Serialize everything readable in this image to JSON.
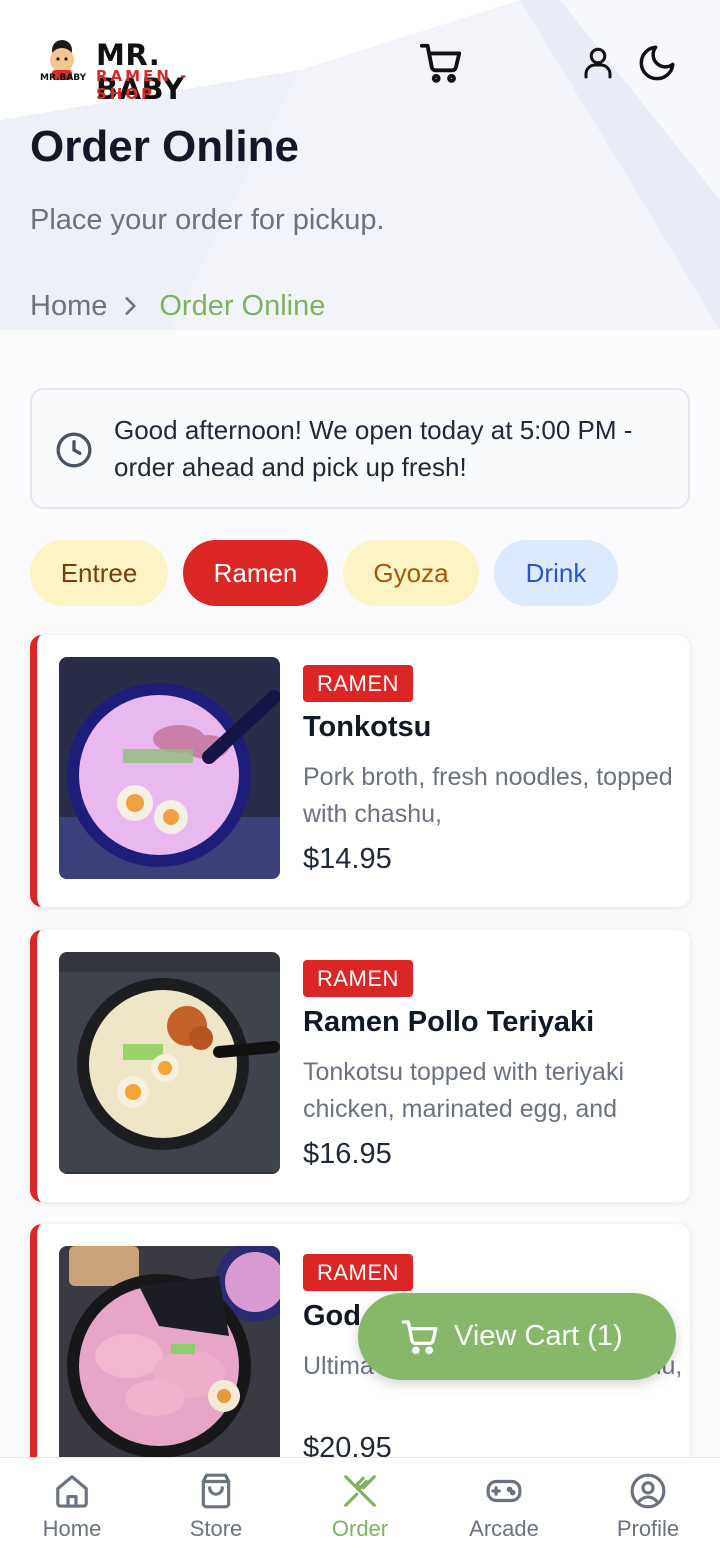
{
  "header": {
    "logo_title": "MR. BABY",
    "logo_sub": "RAMEN - SHOP"
  },
  "page": {
    "title": "Order Online",
    "subtitle": "Place your order for pickup."
  },
  "breadcrumb": {
    "home": "Home",
    "current": "Order Online"
  },
  "notice": {
    "text": "Good afternoon! We open today at 5:00 PM - order ahead and pick up fresh!"
  },
  "categories": [
    {
      "label": "Entree",
      "color": "#fdf4c6"
    },
    {
      "label": "Ramen",
      "color": "#dc2626",
      "selected": true
    },
    {
      "label": "Gyoza",
      "color": "#fdf4c6"
    },
    {
      "label": "Drink",
      "color": "#dbeafe"
    }
  ],
  "menu_items": [
    {
      "category": "RAMEN",
      "name": "Tonkotsu",
      "description": "Pork broth, fresh noodles, topped with chashu,",
      "price": "$14.95"
    },
    {
      "category": "RAMEN",
      "name": "Ramen Pollo Teriyaki",
      "description": "Tonkotsu topped with teriyaki chicken, marinated egg, and",
      "price": "$16.95"
    },
    {
      "category": "RAMEN",
      "name": "God",
      "description": "Ultima tonkotsu with triple chashu,",
      "price": "$20.95"
    }
  ],
  "cart_button": {
    "label": "View Cart (1)"
  },
  "tabbar": [
    {
      "label": "Home",
      "icon": "home-icon"
    },
    {
      "label": "Store",
      "icon": "bag-icon"
    },
    {
      "label": "Order",
      "icon": "utensils-icon",
      "active": true
    },
    {
      "label": "Arcade",
      "icon": "gamepad-icon"
    },
    {
      "label": "Profile",
      "icon": "user-circle-icon"
    }
  ],
  "colors": {
    "accent_green": "#7db35e",
    "ramen_red": "#dc2626"
  }
}
